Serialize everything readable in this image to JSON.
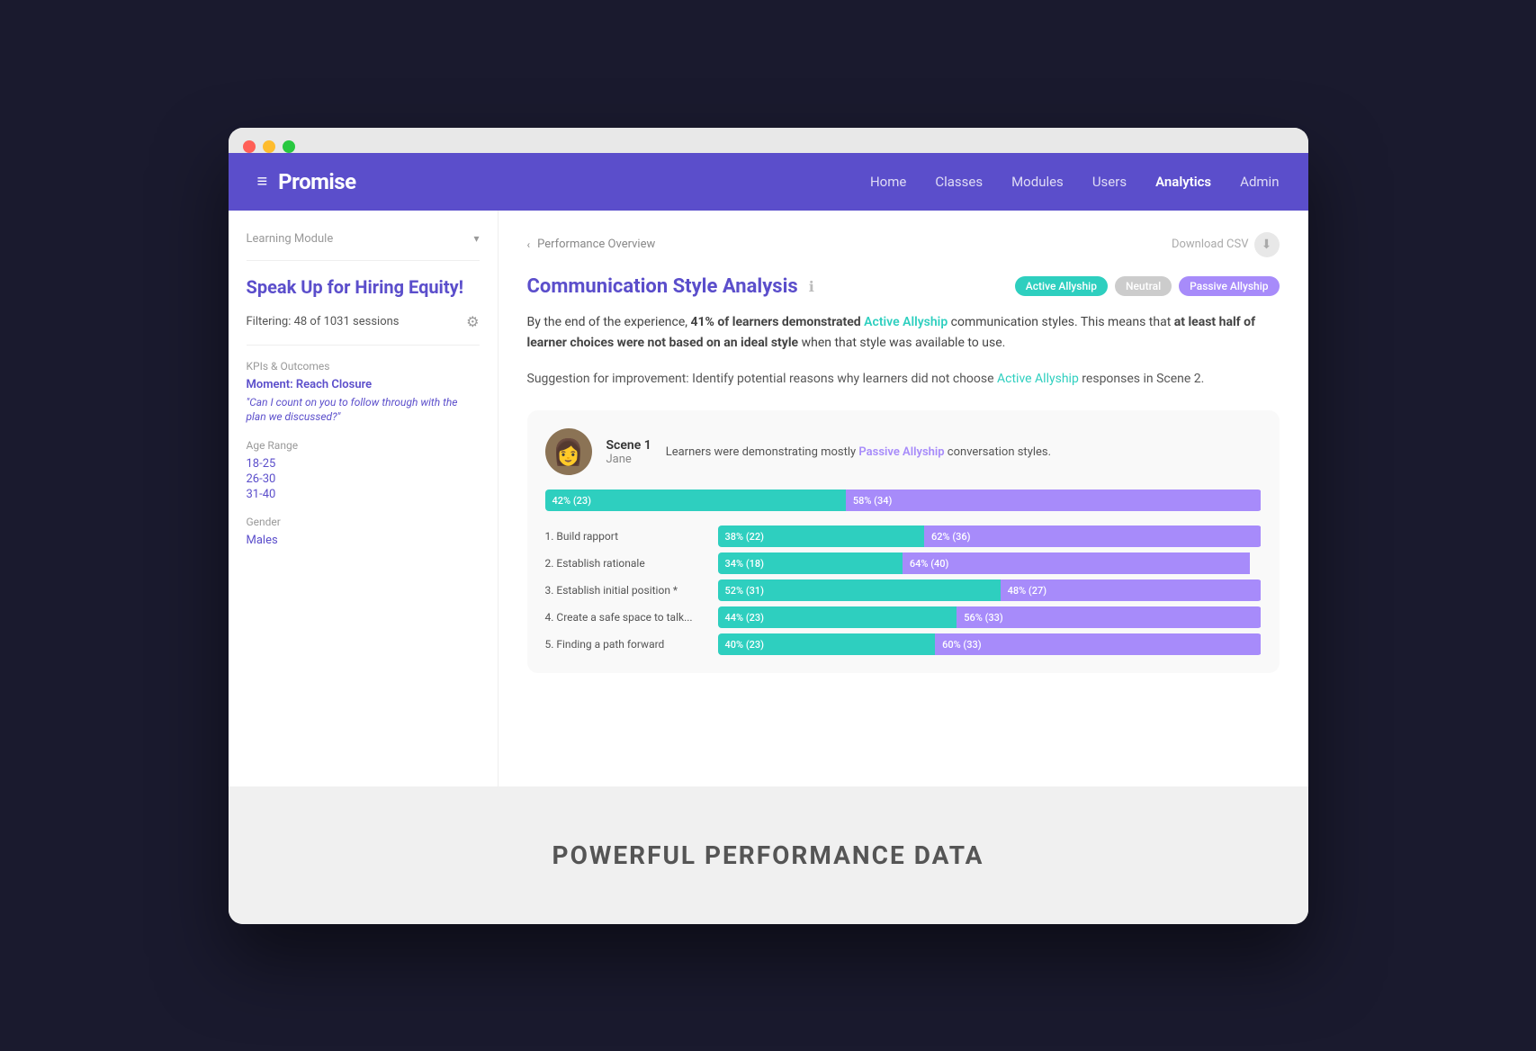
{
  "browser": {
    "traffic_lights": [
      "red",
      "yellow",
      "green"
    ]
  },
  "nav": {
    "logo": "Promise",
    "hamburger": "≡",
    "links": [
      {
        "label": "Home",
        "active": false
      },
      {
        "label": "Classes",
        "active": false
      },
      {
        "label": "Modules",
        "active": false
      },
      {
        "label": "Users",
        "active": false
      },
      {
        "label": "Analytics",
        "active": true
      },
      {
        "label": "Admin",
        "active": false
      }
    ]
  },
  "sidebar": {
    "module_selector": "Learning Module",
    "module_chevron": "▾",
    "title": "Speak Up for Hiring Equity!",
    "filter_text": "Filtering: 48 of 1031 sessions",
    "kpis_label": "KPIs & Outcomes",
    "kpi_title": "Moment: Reach Closure",
    "kpi_quote": "\"Can I count on you to follow through with the plan we discussed?\"",
    "age_range_label": "Age Range",
    "age_values": [
      "18-25",
      "26-30",
      "31-40"
    ],
    "gender_label": "Gender",
    "gender_value": "Males"
  },
  "breadcrumb": {
    "back_label": "Performance Overview",
    "chevron": "‹"
  },
  "download": {
    "label": "Download CSV",
    "icon": "⬇"
  },
  "analysis": {
    "title": "Communication Style Analysis",
    "info_icon": "ℹ",
    "badges": [
      {
        "label": "Active Allyship",
        "type": "active"
      },
      {
        "label": "Neutral",
        "type": "neutral"
      },
      {
        "label": "Passive Allyship",
        "type": "passive"
      }
    ],
    "description_prefix": "By the end of the experience, ",
    "description_bold": "41% of learners demonstrated ",
    "description_highlight": "Active Allyship",
    "description_suffix1": " communication styles. This means that ",
    "description_bold2": "at least half of learner choices were not based on an ideal style",
    "description_suffix2": " when that style was available to use.",
    "suggestion_prefix": "Suggestion for improvement: Identify potential reasons why learners did not choose ",
    "suggestion_link": "Active Allyship",
    "suggestion_suffix": " responses in Scene 2."
  },
  "scene": {
    "avatar_emoji": "👩",
    "label": "Scene 1",
    "name": "Jane",
    "description_prefix": "Learners were demonstrating mostly ",
    "description_highlight": "Passive Allyship",
    "description_suffix": " conversation styles.",
    "main_bar": {
      "teal_pct": 42,
      "teal_label": "42% (23)",
      "purple_pct": 58,
      "purple_label": "58% (34)"
    },
    "choices": [
      {
        "label": "1. Build rapport",
        "teal_pct": 38,
        "teal_label": "38% (22)",
        "purple_pct": 62,
        "purple_label": "62% (36)"
      },
      {
        "label": "2. Establish rationale",
        "teal_pct": 34,
        "teal_label": "34% (18)",
        "purple_pct": 64,
        "purple_label": "64% (40)"
      },
      {
        "label": "3. Establish initial position *",
        "teal_pct": 52,
        "teal_label": "52% (31)",
        "purple_pct": 48,
        "purple_label": "48% (27)"
      },
      {
        "label": "4. Create a safe space to talk...",
        "teal_pct": 44,
        "teal_label": "44% (23)",
        "purple_pct": 56,
        "purple_label": "56% (33)"
      },
      {
        "label": "5. Finding a path forward",
        "teal_pct": 40,
        "teal_label": "40% (23)",
        "purple_pct": 60,
        "purple_label": "60% (33)"
      }
    ]
  },
  "footer": {
    "watermark": "POWERFUL PERFORMANCE DATA"
  }
}
